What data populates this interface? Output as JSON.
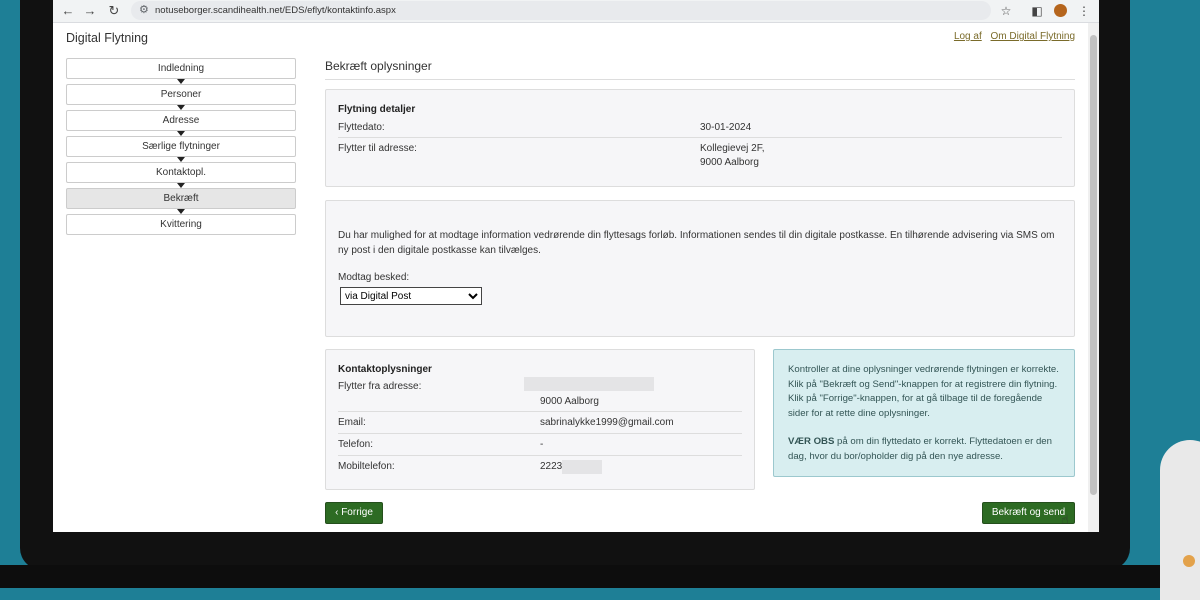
{
  "browser": {
    "url": "notuseborger.scandihealth.net/EDS/eflyt/kontaktinfo.aspx"
  },
  "page": {
    "title": "Digital Flytning",
    "links": {
      "logout": "Log af",
      "about": "Om Digital Flytning"
    }
  },
  "steps": [
    {
      "label": "Indledning",
      "active": false
    },
    {
      "label": "Personer",
      "active": false
    },
    {
      "label": "Adresse",
      "active": false
    },
    {
      "label": "Særlige flytninger",
      "active": false
    },
    {
      "label": "Kontaktopl.",
      "active": false
    },
    {
      "label": "Bekræft",
      "active": true
    },
    {
      "label": "Kvittering",
      "active": false
    }
  ],
  "section_title": "Bekræft oplysninger",
  "details": {
    "heading": "Flytning detaljer",
    "date_label": "Flyttedato:",
    "date_value": "30-01-2024",
    "address_label": "Flytter til adresse:",
    "address_line1": "Kollegievej 2F,",
    "address_line2": "9000 Aalborg"
  },
  "notify": {
    "text": "Du har mulighed for at modtage information vedrørende din flyttesags forløb. Informationen sendes til din digitale postkasse. En tilhørende advisering via SMS om ny post i den digitale postkasse kan tilvælges.",
    "label": "Modtag besked:",
    "selected": "via Digital Post"
  },
  "contact": {
    "heading": "Kontaktoplysninger",
    "from_label": "Flytter fra adresse:",
    "from_city": "9000 Aalborg",
    "email_label": "Email:",
    "email_value": "sabrinalykke1999@gmail.com",
    "phone_label": "Telefon:",
    "phone_value": "-",
    "mobile_label": "Mobiltelefon:",
    "mobile_value": "2223"
  },
  "note": {
    "para1": "Kontroller at dine oplysninger vedrørende flytningen er korrekte. Klik på \"Bekræft og Send\"-knappen for at registrere din flytning. Klik på \"Forrige\"-knappen, for at gå tilbage til de foregående sider for at rette dine oplysninger.",
    "para2_bold": "VÆR OBS",
    "para2_rest": " på om din flyttedato er korrekt. Flyttedatoen er den dag, hvor du bor/opholder dig på den nye adresse."
  },
  "buttons": {
    "back": "Forrige",
    "submit": "Bekræft og send"
  }
}
